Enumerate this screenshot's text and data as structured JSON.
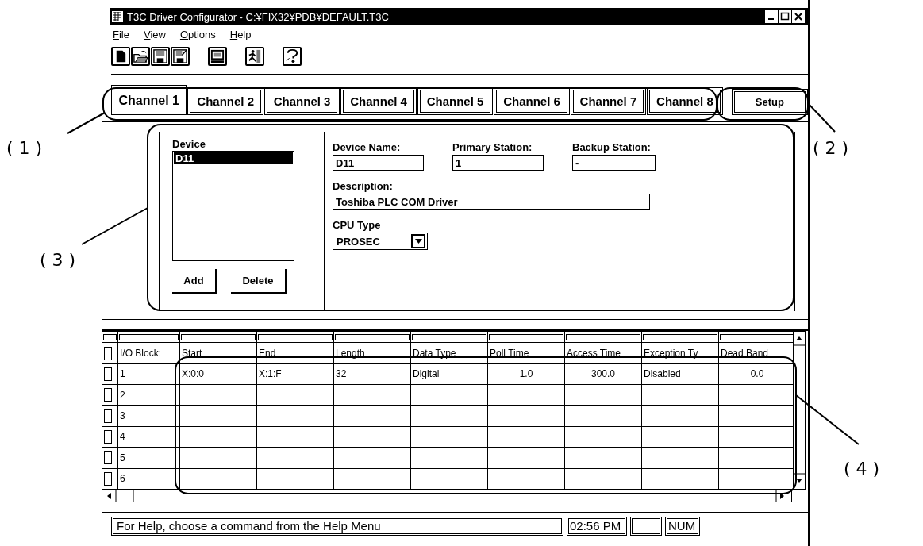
{
  "window": {
    "title": "T3C Driver Configurator - C:¥FIX32¥PDB¥DEFAULT.T3C"
  },
  "menu": [
    "File",
    "View",
    "Options",
    "Help"
  ],
  "tabs": [
    {
      "label": "Channel 1",
      "selected": true
    },
    {
      "label": "Channel 2",
      "selected": false
    },
    {
      "label": "Channel 3",
      "selected": false
    },
    {
      "label": "Channel 4",
      "selected": false
    },
    {
      "label": "Channel 5",
      "selected": false
    },
    {
      "label": "Channel 6",
      "selected": false
    },
    {
      "label": "Channel 7",
      "selected": false
    },
    {
      "label": "Channel 8",
      "selected": false
    }
  ],
  "setup_button": "Setup",
  "device_list": {
    "label": "Device",
    "items": [
      {
        "text": "D11",
        "selected": true
      }
    ],
    "buttons": [
      "Add",
      "Delete"
    ]
  },
  "fields": {
    "device_name": {
      "label": "Device Name:",
      "value": "D11"
    },
    "primary_station": {
      "label": "Primary Station:",
      "value": "1"
    },
    "backup_station": {
      "label": "Backup Station:",
      "value": "-"
    },
    "description": {
      "label": "Description:",
      "value": "Toshiba PLC COM Driver"
    },
    "cpu_type": {
      "label": "CPU Type",
      "value": "PROSEC"
    }
  },
  "table": {
    "columns": [
      {
        "label": "I/O Block:",
        "kind": "text"
      },
      {
        "label": "Start",
        "kind": "text"
      },
      {
        "label": "End",
        "kind": "text"
      },
      {
        "label": "Length",
        "kind": "text"
      },
      {
        "label": "Data Type",
        "kind": "text"
      },
      {
        "label": "Poll Time",
        "kind": "number"
      },
      {
        "label": "Access Time",
        "kind": "number"
      },
      {
        "label": "Exception Ty",
        "kind": "text"
      },
      {
        "label": "Dead Band",
        "kind": "number"
      }
    ],
    "rows": [
      [
        "1",
        "X:0:0",
        "X:1:F",
        "32",
        "Digital",
        "1.0",
        "300.0",
        "Disabled",
        "0.0"
      ],
      [
        "2"
      ],
      [
        "3"
      ],
      [
        "4"
      ],
      [
        "5"
      ],
      [
        "6"
      ]
    ]
  },
  "status_bar": {
    "message": "For Help, choose a command from the Help Menu",
    "time": "02:56 PM",
    "indicator": "NUM"
  },
  "callouts": [
    "( 1 )",
    "( 2 )",
    "( 3 )",
    "( 4 )"
  ]
}
